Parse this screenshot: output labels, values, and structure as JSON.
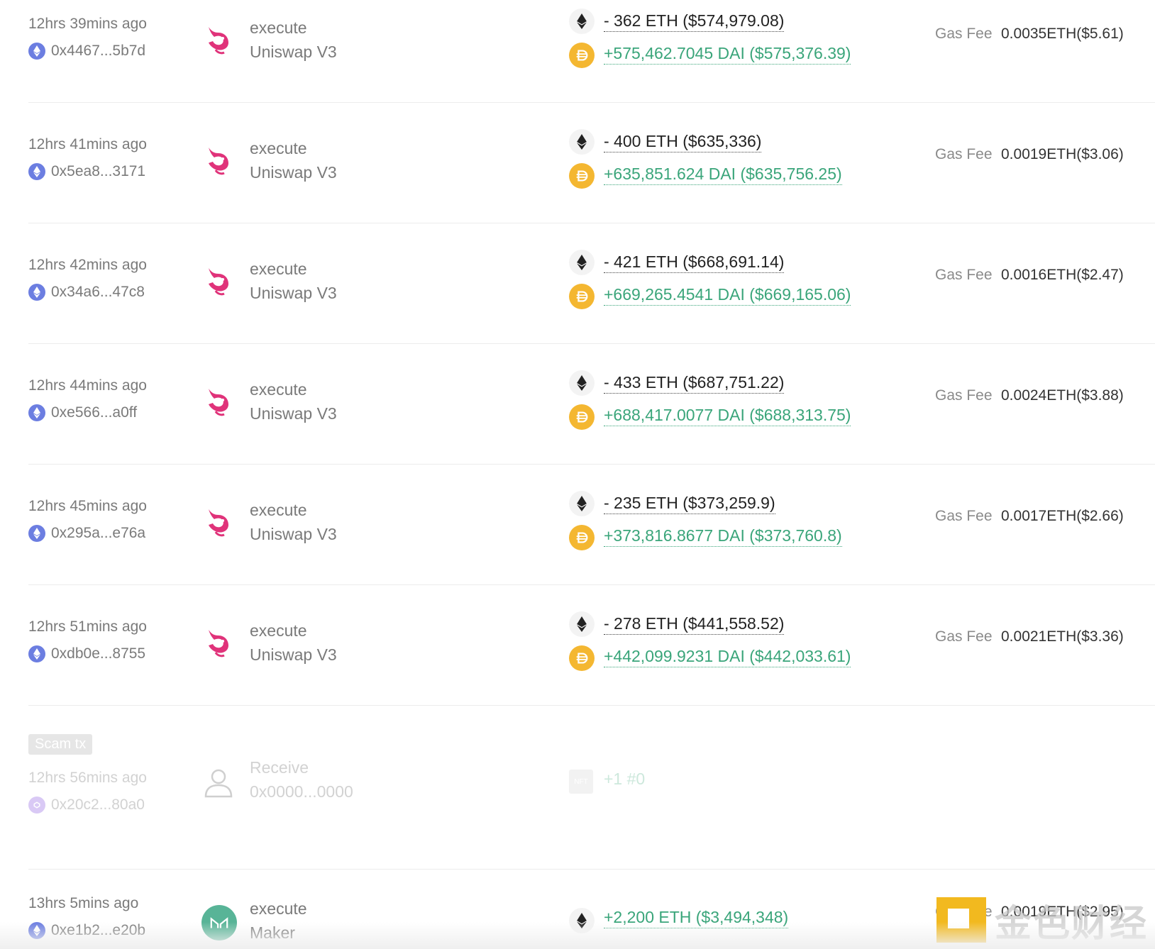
{
  "transactions": [
    {
      "time": "12hrs 39mins ago",
      "address": "0x4467...5b7d",
      "action": "execute",
      "app": "Uniswap V3",
      "out": "- 362 ETH ($574,979.08)",
      "in": "+575,462.7045 DAI ($575,376.39)",
      "gas_label": "Gas Fee",
      "gas": "0.0035ETH($5.61)"
    },
    {
      "time": "12hrs 41mins ago",
      "address": "0x5ea8...3171",
      "action": "execute",
      "app": "Uniswap V3",
      "out": "- 400 ETH ($635,336)",
      "in": "+635,851.624 DAI ($635,756.25)",
      "gas_label": "Gas Fee",
      "gas": "0.0019ETH($3.06)"
    },
    {
      "time": "12hrs 42mins ago",
      "address": "0x34a6...47c8",
      "action": "execute",
      "app": "Uniswap V3",
      "out": "- 421 ETH ($668,691.14)",
      "in": "+669,265.4541 DAI ($669,165.06)",
      "gas_label": "Gas Fee",
      "gas": "0.0016ETH($2.47)"
    },
    {
      "time": "12hrs 44mins ago",
      "address": "0xe566...a0ff",
      "action": "execute",
      "app": "Uniswap V3",
      "out": "- 433 ETH ($687,751.22)",
      "in": "+688,417.0077 DAI ($688,313.75)",
      "gas_label": "Gas Fee",
      "gas": "0.0024ETH($3.88)"
    },
    {
      "time": "12hrs 45mins ago",
      "address": "0x295a...e76a",
      "action": "execute",
      "app": "Uniswap V3",
      "out": "- 235 ETH ($373,259.9)",
      "in": "+373,816.8677 DAI ($373,760.8)",
      "gas_label": "Gas Fee",
      "gas": "0.0017ETH($2.66)"
    },
    {
      "time": "12hrs 51mins ago",
      "address": "0xdb0e...8755",
      "action": "execute",
      "app": "Uniswap V3",
      "out": "- 278 ETH ($441,558.52)",
      "in": "+442,099.9231 DAI ($442,033.61)",
      "gas_label": "Gas Fee",
      "gas": "0.0021ETH($3.36)"
    }
  ],
  "scam_tx": {
    "badge": "Scam tx",
    "time": "12hrs 56mins ago",
    "address": "0x20c2...80a0",
    "action": "Receive",
    "from": "0x0000...0000",
    "nft_label": "NFT",
    "amount": "+1 #0"
  },
  "maker_tx": {
    "time": "13hrs 5mins ago",
    "address": "0xe1b2...e20b",
    "action": "execute",
    "app": "Maker",
    "in": "+2,200 ETH ($3,494,348)",
    "gas_label": "Gas Fee",
    "gas": "0.0019ETH($2.95)"
  },
  "watermark": {
    "text": "金色财经"
  },
  "colors": {
    "positive": "#3aa57a",
    "uniswap": "#e0337a",
    "dai": "#f4b731",
    "eth_chain": "#6c7ee1",
    "maker": "#58b497"
  }
}
